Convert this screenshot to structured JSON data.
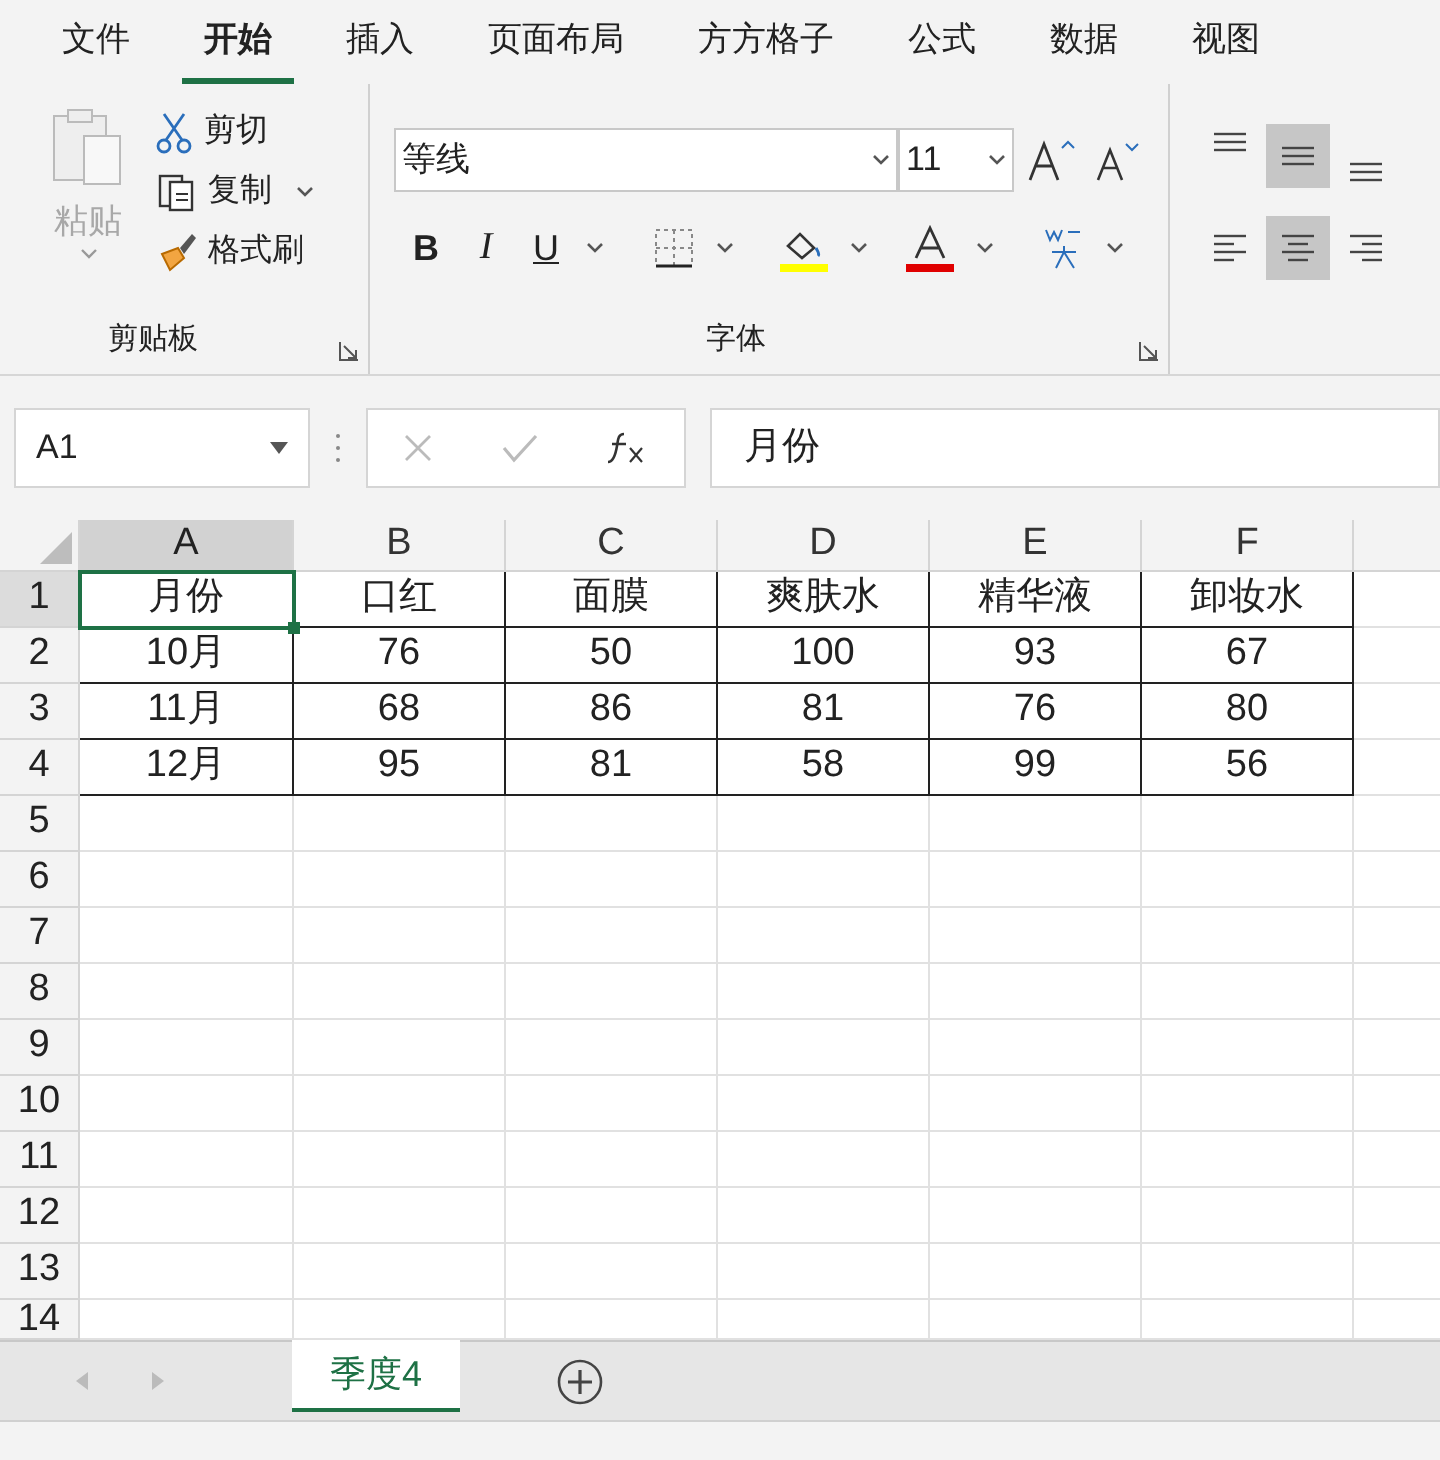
{
  "ribbon_tabs": [
    {
      "label": "文件",
      "selected": false
    },
    {
      "label": "开始",
      "selected": true
    },
    {
      "label": "插入",
      "selected": false
    },
    {
      "label": "页面布局",
      "selected": false
    },
    {
      "label": "方方格子",
      "selected": false
    },
    {
      "label": "公式",
      "selected": false
    },
    {
      "label": "数据",
      "selected": false
    },
    {
      "label": "视图",
      "selected": false
    }
  ],
  "clipboard": {
    "paste": {
      "label": "粘贴",
      "disabled": true
    },
    "cut": "剪切",
    "copy": "复制",
    "format_painter": "格式刷",
    "group_label": "剪贴板"
  },
  "font": {
    "name": "等线",
    "size": "11",
    "group_label": "字体",
    "bold": "B",
    "italic": "I",
    "underline": "U"
  },
  "alignment": [
    {
      "kind": "top",
      "selected": false
    },
    {
      "kind": "middle",
      "selected": true
    },
    {
      "kind": "bottom",
      "selected": false
    },
    {
      "kind": "left",
      "selected": false
    },
    {
      "kind": "center",
      "selected": true
    },
    {
      "kind": "right",
      "selected": false
    }
  ],
  "formula_bar": {
    "name_box": "A1",
    "value": "月份"
  },
  "columns": [
    {
      "label": "A",
      "selected": true
    },
    {
      "label": "B",
      "selected": false
    },
    {
      "label": "C",
      "selected": false
    },
    {
      "label": "D",
      "selected": false
    },
    {
      "label": "E",
      "selected": false
    },
    {
      "label": "F",
      "selected": false
    }
  ],
  "rows": [
    {
      "label": "1",
      "selected": true,
      "cells": [
        "月份",
        "口红",
        "面膜",
        "爽肤水",
        "精华液",
        "卸妆水"
      ]
    },
    {
      "label": "2",
      "selected": false,
      "cells": [
        "10月",
        "76",
        "50",
        "100",
        "93",
        "67"
      ]
    },
    {
      "label": "3",
      "selected": false,
      "cells": [
        "11月",
        "68",
        "86",
        "81",
        "76",
        "80"
      ]
    },
    {
      "label": "4",
      "selected": false,
      "cells": [
        "12月",
        "95",
        "81",
        "58",
        "99",
        "56"
      ]
    },
    {
      "label": "5",
      "selected": false
    },
    {
      "label": "6",
      "selected": false
    },
    {
      "label": "7",
      "selected": false
    },
    {
      "label": "8",
      "selected": false
    },
    {
      "label": "9",
      "selected": false
    },
    {
      "label": "10",
      "selected": false
    },
    {
      "label": "11",
      "selected": false
    },
    {
      "label": "12",
      "selected": false
    },
    {
      "label": "13",
      "selected": false
    },
    {
      "label": "14",
      "selected": false
    }
  ],
  "sheet_tabs": [
    {
      "label": "季度4",
      "selected": true
    }
  ]
}
